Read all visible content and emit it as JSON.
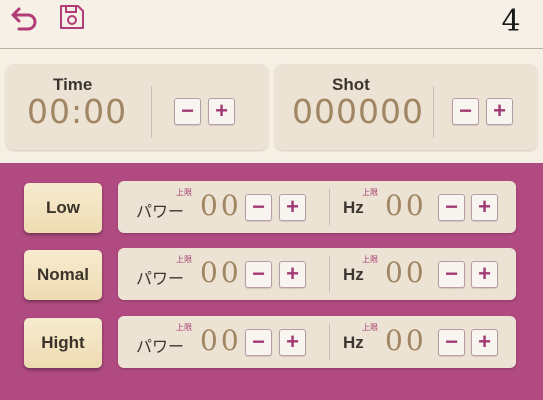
{
  "header": {
    "back_icon": "back-arrow-icon",
    "save_icon": "save-icon",
    "logo_text": "4"
  },
  "time_card": {
    "label": "Time",
    "value": "00:00",
    "minus": "−",
    "plus": "+"
  },
  "shot_card": {
    "label": "Shot",
    "value": "000000",
    "minus": "−",
    "plus": "+"
  },
  "modes": [
    {
      "label": "Low",
      "power_label": "パワー",
      "power_limit": "上限",
      "power_value": "00",
      "hz_label": "Hz",
      "hz_limit": "上限",
      "hz_value": "00"
    },
    {
      "label": "Nomal",
      "power_label": "パワー",
      "power_limit": "上限",
      "power_value": "00",
      "hz_label": "Hz",
      "hz_limit": "上限",
      "hz_value": "00"
    },
    {
      "label": "Hight",
      "power_label": "パワー",
      "power_limit": "上限",
      "power_value": "00",
      "hz_label": "Hz",
      "hz_limit": "上限",
      "hz_value": "00"
    }
  ],
  "buttons": {
    "minus": "−",
    "plus": "+"
  },
  "colors": {
    "accent": "#a23a72",
    "panel": "#b04a80",
    "card": "#ede3d4",
    "value_text": "#a08662",
    "mode_button": "#f2e2c0"
  }
}
